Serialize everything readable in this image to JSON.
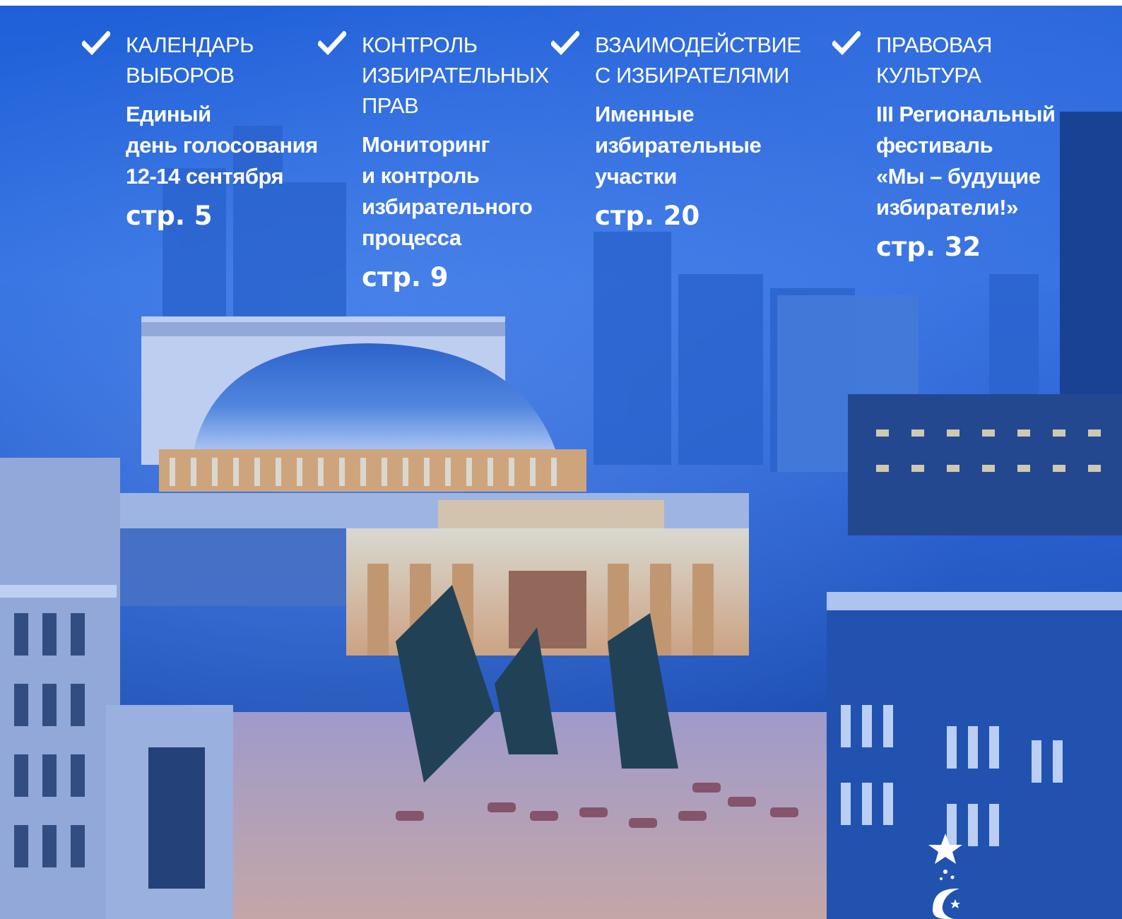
{
  "colors": {
    "background": "#1f5ad0",
    "text": "#ffffff",
    "check": "#ffffff"
  },
  "columns": [
    {
      "category_lines": [
        "КАЛЕНДАРЬ",
        "ВЫБОРОВ"
      ],
      "title_lines": [
        "Единый",
        "день голосования",
        "12-14 сентября"
      ],
      "page": "стр. 5"
    },
    {
      "category_lines": [
        "КОНТРОЛЬ",
        "ИЗБИРАТЕЛЬНЫХ",
        "ПРАВ"
      ],
      "title_lines": [
        "Мониторинг",
        "и контроль",
        "избирательного",
        "процесса"
      ],
      "page": "стр. 9"
    },
    {
      "category_lines": [
        "ВЗАИМОДЕЙСТВИЕ",
        "С ИЗБИРАТЕЛЯМИ"
      ],
      "title_lines": [
        "Именные",
        "избирательные",
        "участки"
      ],
      "page": "стр. 20"
    },
    {
      "category_lines": [
        "ПРАВОВАЯ",
        "КУЛЬТУРА"
      ],
      "title_lines": [
        "III Региональный",
        "фестиваль",
        "«Мы – будущие",
        "избиратели!»"
      ],
      "page": "стр. 32"
    }
  ],
  "icons": {
    "bullet": "check-icon",
    "emblem": "star-logo-icon"
  }
}
